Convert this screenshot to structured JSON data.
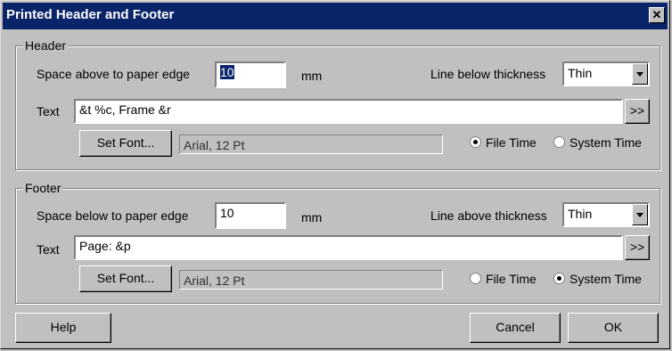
{
  "title": "Printed Header and Footer",
  "header": {
    "legend": "Header",
    "space_label": "Space above to paper edge",
    "space_value": "10",
    "mm": "mm",
    "line_label": "Line below thickness",
    "line_value": "Thin",
    "text_label": "Text",
    "text_value": "&t %c, Frame &r",
    "more": ">>",
    "set_font": "Set Font...",
    "font_value": "Arial, 12 Pt",
    "file_time": "File Time",
    "system_time": "System Time",
    "selected": "file_time"
  },
  "footer": {
    "legend": "Footer",
    "space_label": "Space below to paper edge",
    "space_value": "10",
    "mm": "mm",
    "line_label": "Line above thickness",
    "line_value": "Thin",
    "text_label": "Text",
    "text_value": "Page: &p",
    "more": ">>",
    "set_font": "Set Font...",
    "font_value": "Arial, 12 Pt",
    "file_time": "File Time",
    "system_time": "System Time",
    "selected": "system_time"
  },
  "buttons": {
    "help": "Help",
    "cancel": "Cancel",
    "ok": "OK"
  },
  "close_glyph": "✕"
}
